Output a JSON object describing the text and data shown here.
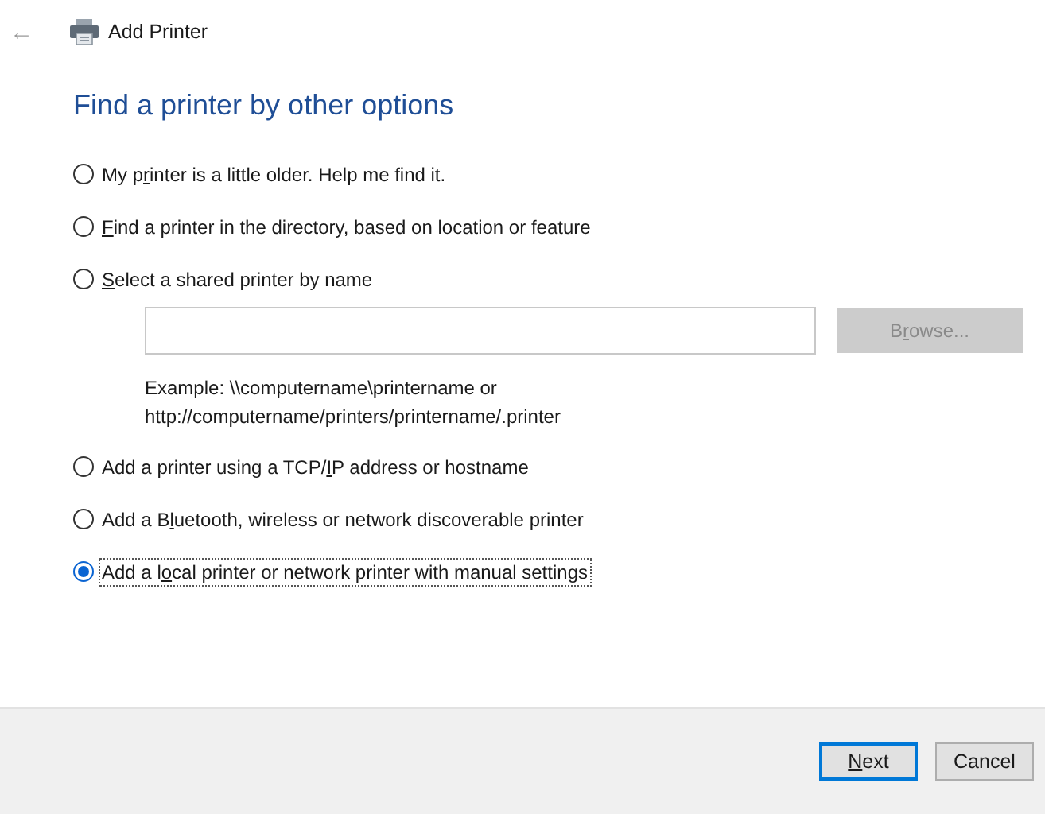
{
  "window": {
    "back": "←",
    "title": "Add Printer"
  },
  "heading": "Find a printer by other options",
  "options": [
    {
      "label": {
        "before": "My p",
        "key": "r",
        "after": "inter is a little older. Help me find it."
      },
      "selected": false,
      "focused": false,
      "kind": "plain"
    },
    {
      "label": {
        "key": "F",
        "after": "ind a printer in the directory, based on location or feature"
      },
      "selected": false,
      "focused": false,
      "kind": "plain"
    },
    {
      "label": {
        "key": "S",
        "after": "elect a shared printer by name"
      },
      "selected": false,
      "focused": false,
      "kind": "name-entry"
    },
    {
      "label": {
        "before": "Add a printer using a TCP/",
        "key": "I",
        "after": "P address or hostname"
      },
      "selected": false,
      "focused": false,
      "kind": "plain"
    },
    {
      "label": {
        "before": "Add a B",
        "key": "l",
        "after": "uetooth, wireless or network discoverable printer"
      },
      "selected": false,
      "focused": false,
      "kind": "plain"
    },
    {
      "label": {
        "before": "Add a l",
        "key": "o",
        "after": "cal printer or network printer with manual settings"
      },
      "selected": true,
      "focused": true,
      "kind": "plain"
    }
  ],
  "name_entry": {
    "browse": {
      "before": "B",
      "key": "r",
      "after": "owse..."
    },
    "browse_disabled": true,
    "example": [
      "Example: \\\\computername\\printername or",
      "http://computername/printers/printername/.printer"
    ]
  },
  "buttons": [
    {
      "label": {
        "key": "N",
        "after": "ext"
      },
      "default": true
    },
    {
      "label": {
        "before": "Cancel"
      },
      "default": false
    }
  ]
}
